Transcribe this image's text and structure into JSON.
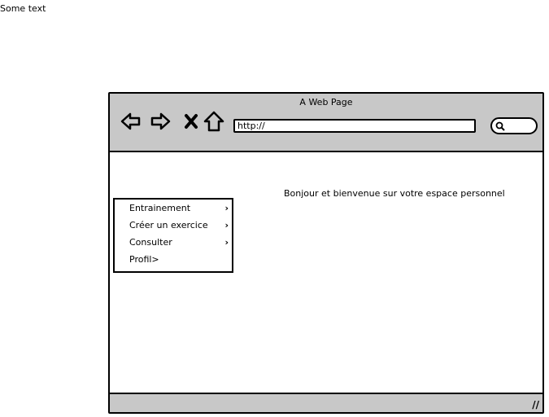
{
  "corner_text": "Some text",
  "window": {
    "title": "A Web Page",
    "url": "http://",
    "welcome": "Bonjour et bienvenue sur votre espace personnel",
    "chrome_color": "#c8c8c8"
  },
  "toolbar": {
    "icons": [
      "back-arrow-icon",
      "forward-arrow-icon",
      "close-icon",
      "home-icon",
      "search-icon"
    ]
  },
  "menu": {
    "items": [
      {
        "label": "Entrainement",
        "chevron": "›"
      },
      {
        "label": "Créer un exercice",
        "chevron": "›"
      },
      {
        "label": "Consulter",
        "chevron": "›"
      },
      {
        "label": "Profil>",
        "chevron": ""
      }
    ]
  },
  "statusbar": {
    "grip": "//"
  }
}
